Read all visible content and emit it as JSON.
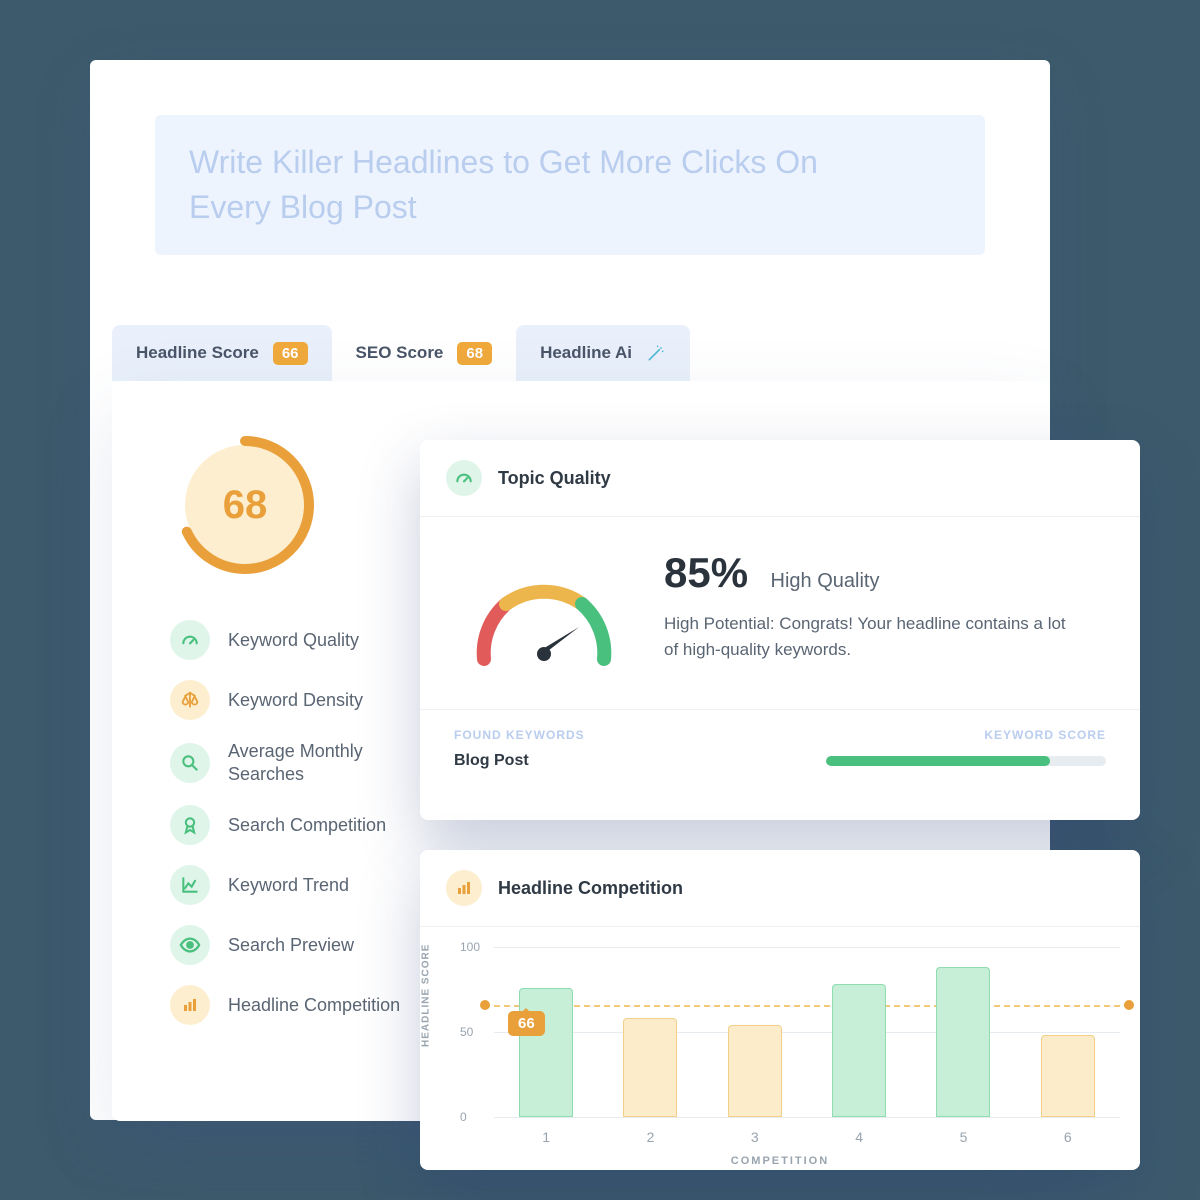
{
  "headline": "Write Killer Headlines to Get More Clicks On Every Blog Post",
  "tabs": [
    {
      "label": "Headline Score",
      "badge": "66"
    },
    {
      "label": "SEO Score",
      "badge": "68"
    },
    {
      "label": "Headline Ai"
    }
  ],
  "score_circle": {
    "value": "68",
    "percent": 68
  },
  "metrics": [
    {
      "label": "Keyword Quality",
      "color": "green",
      "icon": "gauge"
    },
    {
      "label": "Keyword Density",
      "color": "orange",
      "icon": "scale"
    },
    {
      "label": "Average Monthly Searches",
      "color": "green",
      "icon": "search"
    },
    {
      "label": "Search Competition",
      "color": "green",
      "icon": "ribbon"
    },
    {
      "label": "Keyword Trend",
      "color": "green",
      "icon": "trend"
    },
    {
      "label": "Search Preview",
      "color": "green",
      "icon": "eye"
    },
    {
      "label": "Headline Competition",
      "color": "orange",
      "icon": "bars"
    }
  ],
  "topic": {
    "title": "Topic Quality",
    "percent": "85%",
    "gauge_percent": 85,
    "quality_label": "High Quality",
    "description": "High Potential: Congrats! Your headline contains a lot of high-quality keywords.",
    "found_label": "FOUND KEYWORDS",
    "score_label": "KEYWORD SCORE",
    "keyword": "Blog Post",
    "score_fill": 80
  },
  "competition": {
    "title": "Headline Competition",
    "ylabel": "HEADLINE SCORE",
    "xlabel": "COMPETITION",
    "marker": "66"
  },
  "chart_data": {
    "type": "bar",
    "title": "Headline Competition",
    "xlabel": "COMPETITION",
    "ylabel": "HEADLINE SCORE",
    "ylim": [
      0,
      100
    ],
    "yticks": [
      0,
      50,
      100
    ],
    "categories": [
      "1",
      "2",
      "3",
      "4",
      "5",
      "6"
    ],
    "values": [
      76,
      58,
      54,
      78,
      88,
      48
    ],
    "colors": [
      "green",
      "orange",
      "orange",
      "green",
      "green",
      "orange"
    ],
    "reference_line": 66,
    "marker_value": 66
  }
}
